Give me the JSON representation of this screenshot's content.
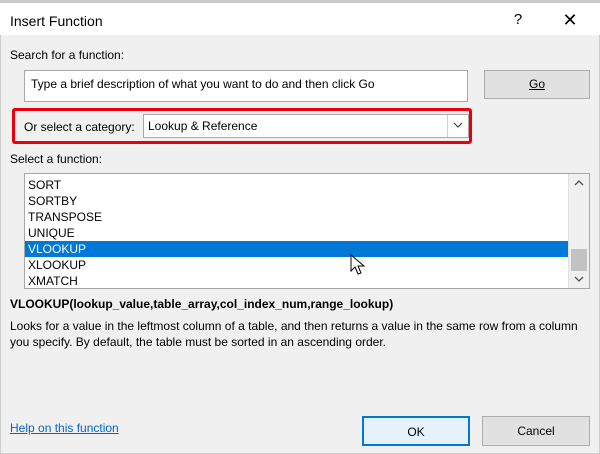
{
  "window": {
    "title": "Insert Function",
    "help_glyph": "?",
    "close_glyph": "✕"
  },
  "search": {
    "label": "Search for a function:",
    "input_value": "Type a brief description of what you want to do and then click Go",
    "go_label": "Go"
  },
  "category": {
    "label": "Or select a category:",
    "selected": "Lookup & Reference",
    "highlight_color": "#e8000f"
  },
  "functions": {
    "label": "Select a function:",
    "items": [
      "SORT",
      "SORTBY",
      "TRANSPOSE",
      "UNIQUE",
      "VLOOKUP",
      "XLOOKUP",
      "XMATCH"
    ],
    "selected": "VLOOKUP",
    "selection_color": "#0078d7"
  },
  "details": {
    "syntax": "VLOOKUP(lookup_value,table_array,col_index_num,range_lookup)",
    "description": "Looks for a value in the leftmost column of a table, and then returns a value in the same row from a column you specify. By default, the table must be sorted in an ascending order."
  },
  "footer": {
    "help_link": "Help on this function",
    "ok_label": "OK",
    "cancel_label": "Cancel"
  }
}
